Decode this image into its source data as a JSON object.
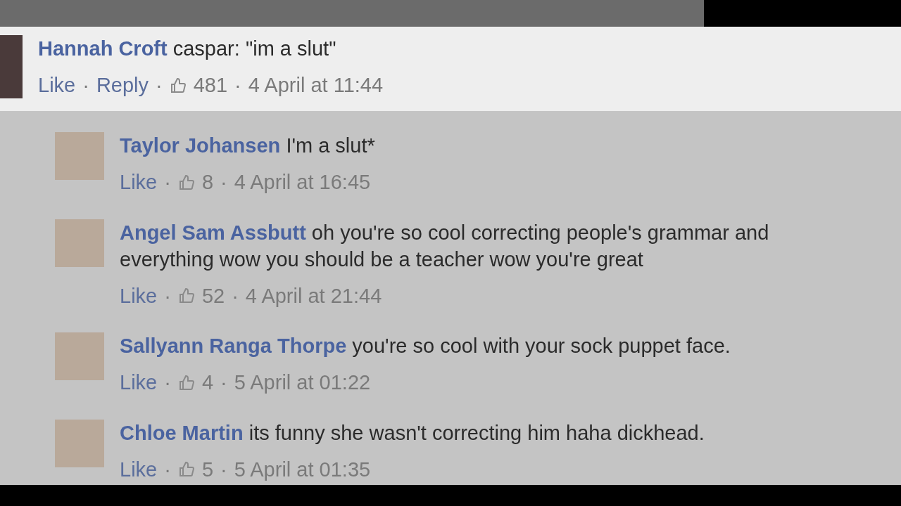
{
  "separator": "·",
  "comments": [
    {
      "kind": "comment",
      "author": "Hannah Croft",
      "text": "caspar: \"im a slut\"",
      "actions": [
        "Like",
        "Reply"
      ],
      "likes": "481",
      "time": "4 April at 11:44"
    },
    {
      "kind": "reply",
      "author": "Taylor Johansen",
      "text": "I'm a slut*",
      "actions": [
        "Like"
      ],
      "likes": "8",
      "time": "4 April at 16:45"
    },
    {
      "kind": "reply",
      "author": "Angel Sam Assbutt",
      "text": "oh you're so cool correcting people's grammar and everything wow you should be a teacher wow you're great",
      "actions": [
        "Like"
      ],
      "likes": "52",
      "time": "4 April at 21:44"
    },
    {
      "kind": "reply",
      "author": "Sallyann Ranga Thorpe",
      "text": "you're so cool with your sock puppet face.",
      "actions": [
        "Like"
      ],
      "likes": "4",
      "time": "5 April at 01:22"
    },
    {
      "kind": "reply",
      "author": "Chloe Martin",
      "text": "its funny she wasn't correcting him haha dickhead.",
      "actions": [
        "Like"
      ],
      "likes": "5",
      "time": "5 April at 01:35"
    }
  ]
}
